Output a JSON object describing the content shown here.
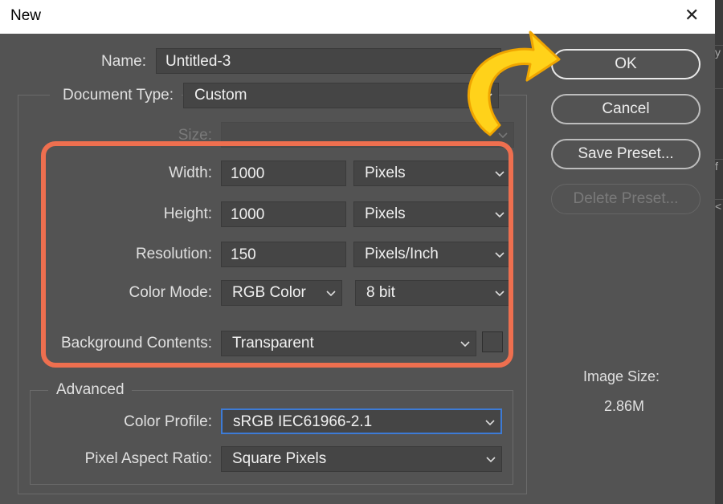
{
  "window": {
    "title": "New",
    "close_glyph": "✕"
  },
  "fields": {
    "name": {
      "label": "Name:",
      "value": "Untitled-3"
    },
    "document_type": {
      "label": "Document Type:",
      "value": "Custom"
    },
    "size": {
      "label": "Size:",
      "value": ""
    },
    "width": {
      "label": "Width:",
      "value": "1000",
      "unit": "Pixels"
    },
    "height": {
      "label": "Height:",
      "value": "1000",
      "unit": "Pixels"
    },
    "resolution": {
      "label": "Resolution:",
      "value": "150",
      "unit": "Pixels/Inch"
    },
    "color_mode": {
      "label": "Color Mode:",
      "value": "RGB Color",
      "depth": "8 bit"
    },
    "background": {
      "label": "Background Contents:",
      "value": "Transparent"
    }
  },
  "advanced": {
    "title": "Advanced",
    "color_profile": {
      "label": "Color Profile:",
      "value": "sRGB IEC61966-2.1"
    },
    "pixel_aspect": {
      "label": "Pixel Aspect Ratio:",
      "value": "Square Pixels"
    }
  },
  "buttons": {
    "ok": "OK",
    "cancel": "Cancel",
    "save_preset": "Save Preset...",
    "delete_preset": "Delete Preset..."
  },
  "image_size": {
    "label": "Image Size:",
    "value": "2.86M"
  },
  "annotations": {
    "highlight_color": "#ee6f4f",
    "arrow_color": "#ffd21a",
    "arrow_icon": "curved-arrow-icon"
  },
  "right_strip_glyphs": [
    "y",
    "",
    "f",
    "<"
  ]
}
